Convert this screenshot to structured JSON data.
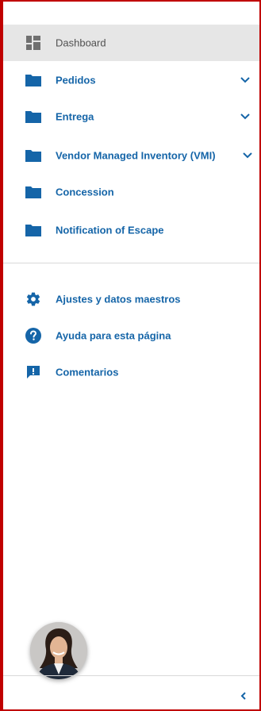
{
  "sidebar": {
    "items": [
      {
        "label": "Dashboard",
        "icon": "dashboard-icon",
        "active": true
      },
      {
        "label": "Pedidos",
        "icon": "folder-icon",
        "expandable": true
      },
      {
        "label": "Entrega",
        "icon": "folder-icon",
        "expandable": true
      },
      {
        "label": "Vendor Managed Inventory (VMI)",
        "icon": "folder-icon",
        "expandable": true
      },
      {
        "label": "Concession",
        "icon": "folder-icon"
      },
      {
        "label": "Notification of Escape",
        "icon": "folder-icon"
      }
    ],
    "utilities": [
      {
        "label": "Ajustes y datos maestros",
        "icon": "gear-icon"
      },
      {
        "label": "Ayuda para esta página",
        "icon": "help-icon"
      },
      {
        "label": "Comentarios",
        "icon": "feedback-icon"
      }
    ]
  },
  "colors": {
    "accent": "#1565a8",
    "active_bg": "#e6e6e6",
    "frame_border": "#c00000"
  }
}
